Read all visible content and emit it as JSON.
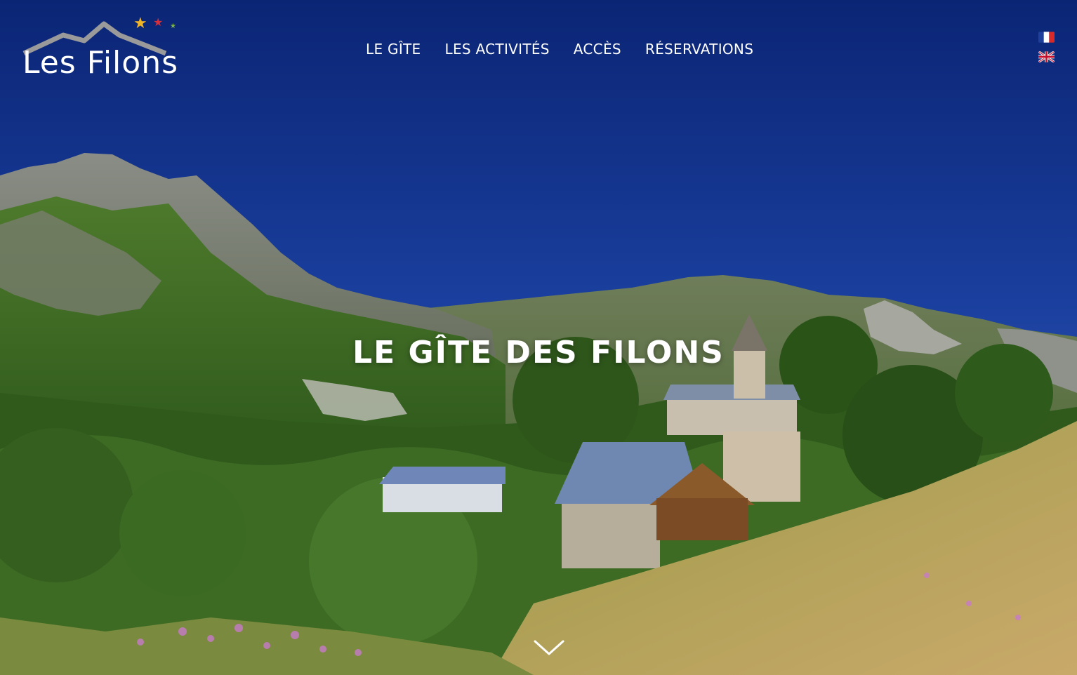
{
  "brand": {
    "logo_text": "Les Filons",
    "star_colors": [
      "#f0b429",
      "#d62f3b",
      "#7cb342"
    ]
  },
  "nav": {
    "items": [
      {
        "label": "LE GÎTE"
      },
      {
        "label": "LES ACTIVITÉS"
      },
      {
        "label": "ACCÈS"
      },
      {
        "label": "RÉSERVATIONS"
      }
    ]
  },
  "languages": [
    {
      "code": "fr",
      "icon": "france-flag-icon"
    },
    {
      "code": "en",
      "icon": "uk-flag-icon"
    }
  ],
  "hero": {
    "title": "LE GÎTE DES FILONS",
    "scroll_icon": "chevron-down-icon"
  },
  "colors": {
    "sky_top": "#0b2575",
    "sky_bottom": "#3c66c2",
    "text": "#ffffff"
  }
}
